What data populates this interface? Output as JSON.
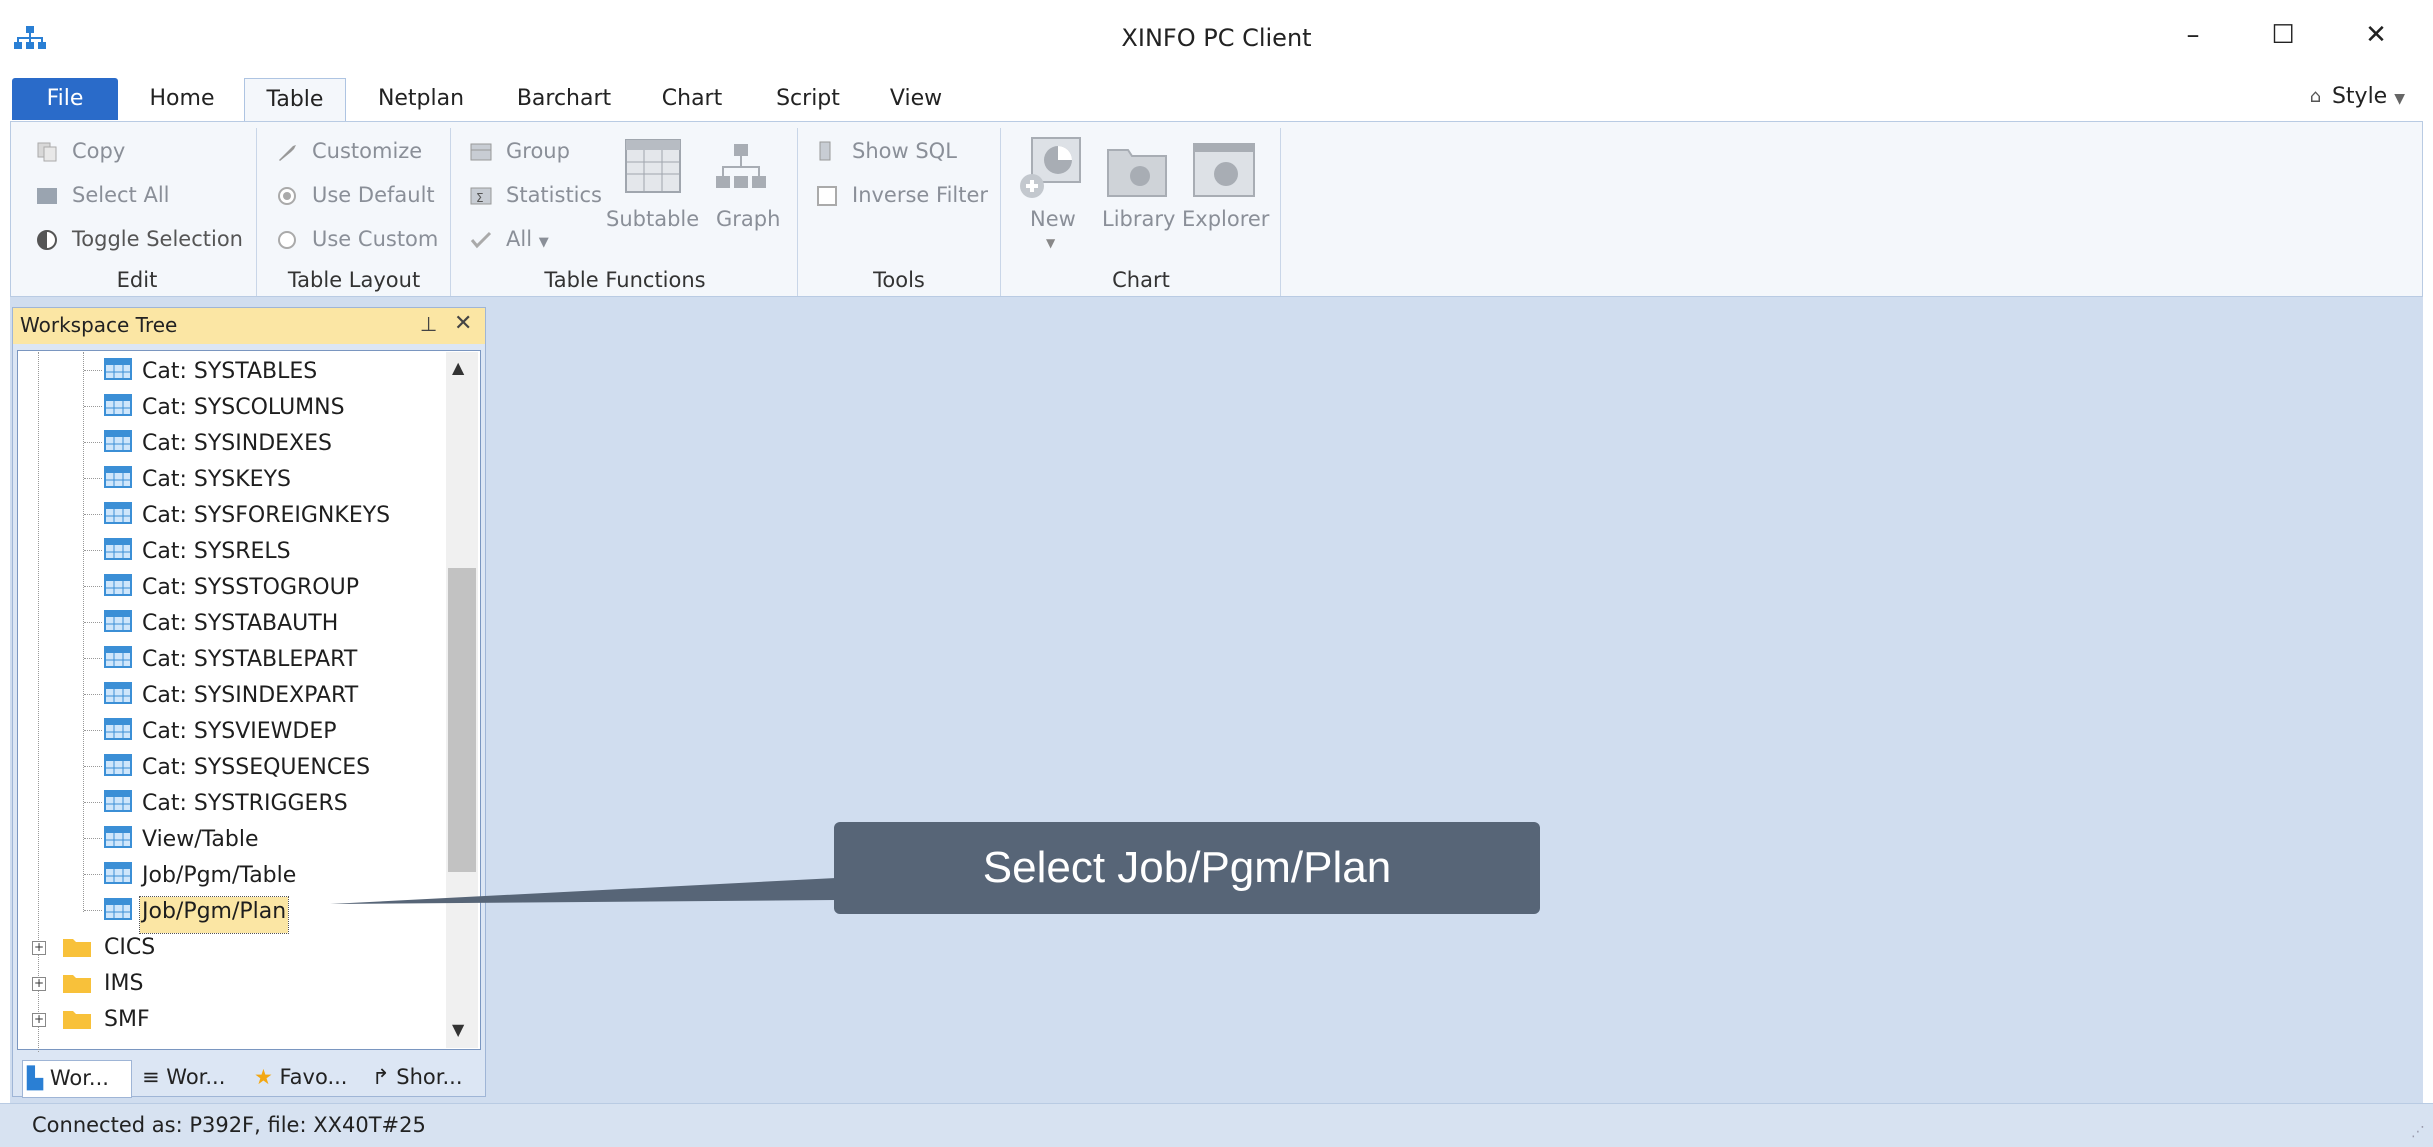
{
  "window": {
    "title": "XINFO PC Client",
    "minimize_label": "–",
    "maximize_label": "☐",
    "close_label": "✕"
  },
  "menu": {
    "tabs": [
      "File",
      "Home",
      "Table",
      "Netplan",
      "Barchart",
      "Chart",
      "Script",
      "View"
    ],
    "active_tab": "Table",
    "style_label": "Style"
  },
  "ribbon": {
    "edit": {
      "copy": "Copy",
      "select_all": "Select All",
      "toggle_selection": "Toggle Selection",
      "group_label": "Edit"
    },
    "table_layout": {
      "customize": "Customize",
      "use_default": "Use Default",
      "use_custom": "Use Custom",
      "group_label": "Table Layout"
    },
    "table_functions": {
      "group": "Group",
      "statistics": "Statistics",
      "all": "All",
      "subtable": "Subtable",
      "graph": "Graph",
      "group_label": "Table Functions"
    },
    "tools": {
      "show_sql": "Show SQL",
      "inverse_filter": "Inverse Filter",
      "group_label": "Tools"
    },
    "chart": {
      "new": "New",
      "library": "Library",
      "explorer": "Explorer",
      "group_label": "Chart"
    }
  },
  "workspace_panel": {
    "title": "Workspace Tree",
    "pin_label": "⊥",
    "close_label": "✕",
    "tree_items": [
      "Cat: SYSTABLES",
      "Cat: SYSCOLUMNS",
      "Cat: SYSINDEXES",
      "Cat: SYSKEYS",
      "Cat: SYSFOREIGNKEYS",
      "Cat: SYSRELS",
      "Cat: SYSSTOGROUP",
      "Cat: SYSTABAUTH",
      "Cat: SYSTABLEPART",
      "Cat: SYSINDEXPART",
      "Cat: SYSVIEWDEP",
      "Cat: SYSSEQUENCES",
      "Cat: SYSTRIGGERS",
      "View/Table",
      "Job/Pgm/Table",
      "Job/Pgm/Plan"
    ],
    "selected_item": "Job/Pgm/Plan",
    "folders": [
      "CICS",
      "IMS",
      "SMF"
    ],
    "bottom_tabs": [
      "Wor...",
      "Wor...",
      "Favo...",
      "Shor..."
    ]
  },
  "status_bar": {
    "text": "Connected as: P392F, file: XX40T#25"
  },
  "callout": {
    "text": "Select  Job/Pgm/Plan"
  },
  "colors": {
    "file_tab": "#2a6bc9",
    "workspace": "#d0ddef",
    "panel_header": "#fbe6a4",
    "callout": "#576577",
    "selection": "#fbe6a4"
  }
}
